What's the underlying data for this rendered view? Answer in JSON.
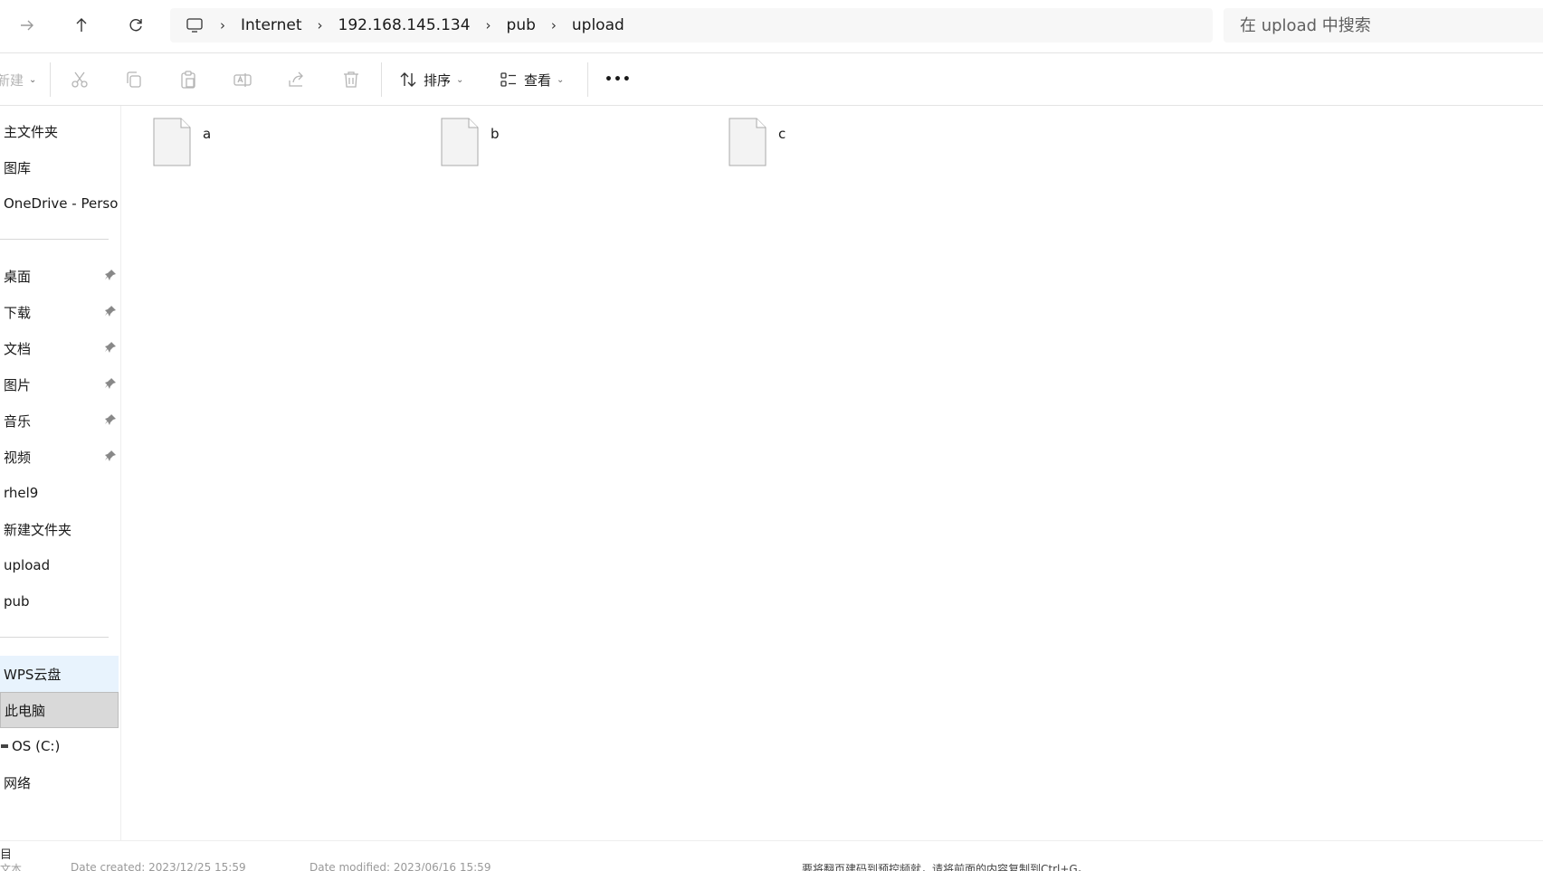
{
  "nav": {
    "forward_icon": "arrow-right-icon",
    "up_icon": "arrow-up-icon",
    "refresh_icon": "refresh-icon"
  },
  "breadcrumb": {
    "root_icon": "monitor-icon",
    "separator": "›",
    "items": [
      "Internet",
      "192.168.145.134",
      "pub",
      "upload"
    ]
  },
  "search": {
    "placeholder": "在 upload 中搜索"
  },
  "toolbar": {
    "new_label": "新建",
    "sort_label": "排序",
    "view_label": "查看",
    "more_label": "•••",
    "icons": [
      "cut-icon",
      "copy-icon",
      "paste-icon",
      "rename-icon",
      "share-icon",
      "delete-icon"
    ]
  },
  "sidebar": {
    "top_items": [
      "主文件夹",
      "图库",
      "OneDrive - Personal"
    ],
    "pinned_items": [
      "桌面",
      "下载",
      "文档",
      "图片",
      "音乐",
      "视频"
    ],
    "recent_items": [
      "rhel9",
      "新建文件夹",
      "upload",
      "pub"
    ],
    "bottom_items": [
      "WPS云盘",
      "此电脑",
      "OS (C:)",
      "网络"
    ]
  },
  "files": [
    {
      "name": "a",
      "icon": "file-icon"
    },
    {
      "name": "b",
      "icon": "file-icon"
    },
    {
      "name": "c",
      "icon": "file-icon"
    }
  ],
  "statusbar": {
    "item_count": "目",
    "fragment_1": "文本",
    "fragment_2": "Date created: 2023/12/25  15:59",
    "fragment_3": "Date modified: 2023/06/16  15:59",
    "fragment_4": "要将翻页建码到预控频就，请将前面的内容复制到Ctrl+G。"
  },
  "colors": {
    "accent_hover": "#e8f3fd",
    "selected_bg": "#d9d9d9",
    "breadcrumb_bg": "#f7f7f7"
  }
}
